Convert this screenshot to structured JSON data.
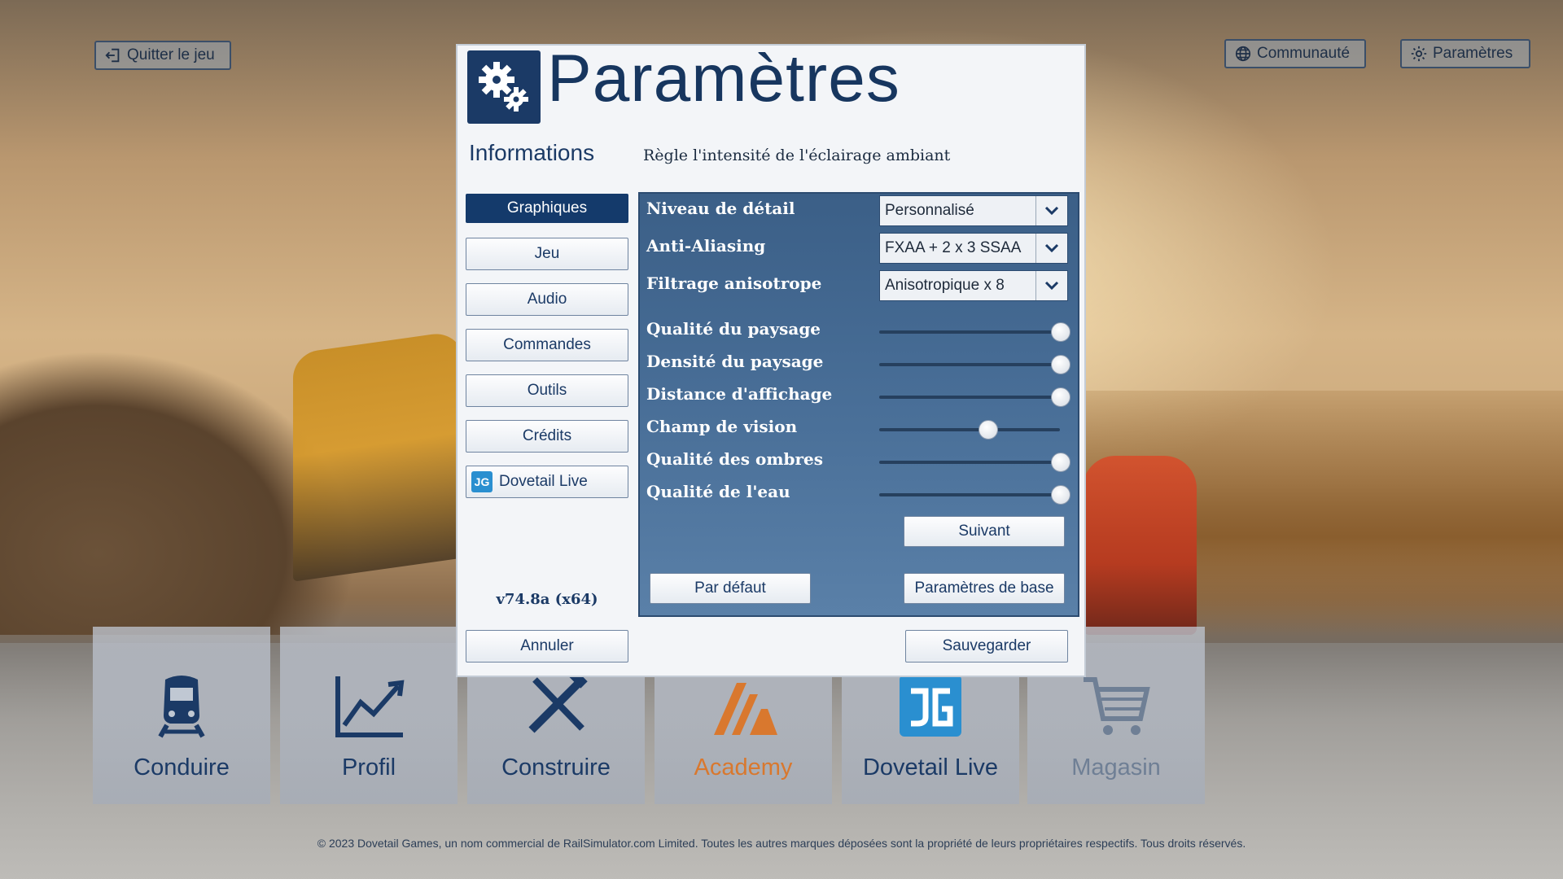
{
  "top_bar": {
    "quit_label": "Quitter le jeu",
    "community_label": "Communauté",
    "settings_label": "Paramètres"
  },
  "dialog": {
    "title": "Paramètres",
    "info_label": "Informations",
    "info_description": "Règle l'intensité de l'éclairage ambiant",
    "nav": [
      {
        "label": "Graphiques",
        "active": true
      },
      {
        "label": "Jeu"
      },
      {
        "label": "Audio"
      },
      {
        "label": "Commandes"
      },
      {
        "label": "Outils"
      },
      {
        "label": "Crédits"
      },
      {
        "label": "Dovetail Live"
      }
    ],
    "version": "v74.8a (x64)",
    "graphics": {
      "dropdowns": [
        {
          "label": "Niveau de détail",
          "value": "Personnalisé"
        },
        {
          "label": "Anti-Aliasing",
          "value": "FXAA + 2 x 3 SSAA"
        },
        {
          "label": "Filtrage anisotrope",
          "value": "Anisotropique x 8"
        }
      ],
      "sliders": [
        {
          "label": "Qualité du paysage",
          "value": 1.0
        },
        {
          "label": "Densité du paysage",
          "value": 1.0
        },
        {
          "label": "Distance d'affichage",
          "value": 1.0
        },
        {
          "label": "Champ de vision",
          "value": 0.6
        },
        {
          "label": "Qualité des ombres",
          "value": 1.0
        },
        {
          "label": "Qualité de l'eau",
          "value": 1.0
        }
      ],
      "next_label": "Suivant",
      "default_label": "Par défaut",
      "basic_label": "Paramètres de base"
    },
    "cancel_label": "Annuler",
    "save_label": "Sauvegarder"
  },
  "tiles": [
    {
      "label": "Conduire",
      "icon": "train-icon",
      "color": "#1b3a66"
    },
    {
      "label": "Profil",
      "icon": "chart-line-icon",
      "color": "#1b3a66"
    },
    {
      "label": "Construire",
      "icon": "tools-icon",
      "color": "#1b3a66"
    },
    {
      "label": "Academy",
      "icon": "academy-icon",
      "color": "#d9782e"
    },
    {
      "label": "Dovetail Live",
      "icon": "dovetail-live-icon",
      "color": "#1b3a66"
    },
    {
      "label": "Magasin",
      "icon": "cart-icon",
      "color": "#6f7f95"
    }
  ],
  "footer": "© 2023 Dovetail Games, un nom commercial de RailSimulator.com Limited. Toutes les autres marques déposées sont la propriété de leurs propriétaires respectifs.  Tous droits réservés."
}
